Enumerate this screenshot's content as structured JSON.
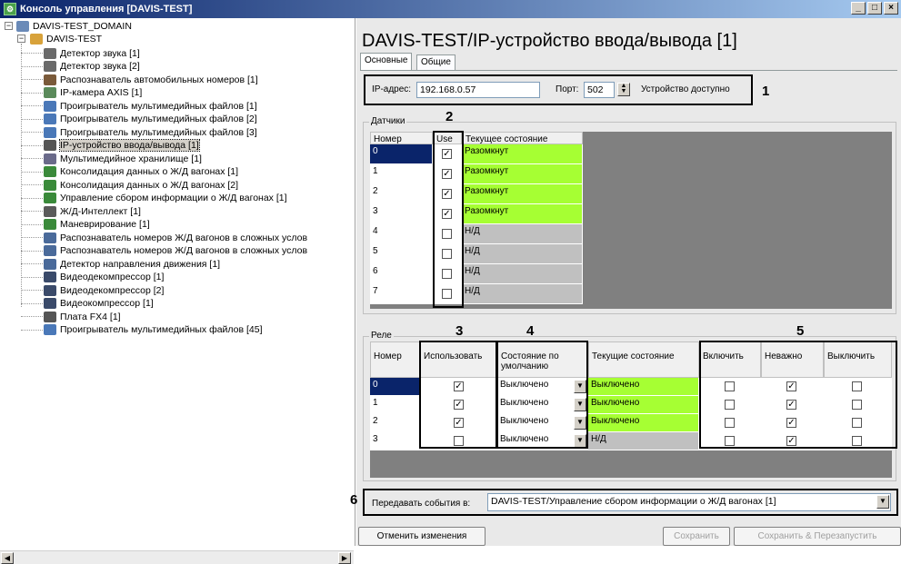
{
  "window": {
    "title": "Консоль управления [DAVIS-TEST]",
    "min": "_",
    "max": "□",
    "close": "×"
  },
  "tree": {
    "root": "DAVIS-TEST_DOMAIN",
    "computer": "DAVIS-TEST",
    "items": [
      {
        "label": "Детектор звука [1]",
        "icon": "sound-detector-icon",
        "color": "#6a6a6a"
      },
      {
        "label": "Детектор звука [2]",
        "icon": "sound-detector-icon",
        "color": "#6a6a6a"
      },
      {
        "label": "Распознаватель автомобильных номеров [1]",
        "icon": "car-plate-icon",
        "color": "#7a5a3a"
      },
      {
        "label": "IP-камера AXIS [1]",
        "icon": "camera-icon",
        "color": "#5a8a5a"
      },
      {
        "label": "Проигрыватель мультимедийных файлов [1]",
        "icon": "player-icon",
        "color": "#4a78b8"
      },
      {
        "label": "Проигрыватель мультимедийных файлов [2]",
        "icon": "player-icon",
        "color": "#4a78b8"
      },
      {
        "label": "Проигрыватель мультимедийных файлов [3]",
        "icon": "player-icon",
        "color": "#4a78b8"
      },
      {
        "label": "IP-устройство ввода/вывода [1]",
        "icon": "io-device-icon",
        "color": "#555555",
        "selected": true
      },
      {
        "label": "Мультимедийное хранилище [1]",
        "icon": "storage-icon",
        "color": "#6a6a8a"
      },
      {
        "label": "Консолидация данных о Ж/Д вагонах [1]",
        "icon": "rail-icon",
        "color": "#3a8a3a"
      },
      {
        "label": "Консолидация данных о Ж/Д вагонах [2]",
        "icon": "rail-icon",
        "color": "#3a8a3a"
      },
      {
        "label": "Управление сбором информации о Ж/Д вагонах [1]",
        "icon": "rail-icon",
        "color": "#3a8a3a"
      },
      {
        "label": "Ж/Д-Интеллект [1]",
        "icon": "rail-intellect-icon",
        "color": "#5a5a5a"
      },
      {
        "label": "Маневрирование [1]",
        "icon": "rail-icon",
        "color": "#3a8a3a"
      },
      {
        "label": "Распознаватель номеров Ж/Д вагонов в сложных услов",
        "icon": "magnifier-icon",
        "color": "#4a6a9a"
      },
      {
        "label": "Распознаватель номеров Ж/Д вагонов в сложных услов",
        "icon": "magnifier-icon",
        "color": "#4a6a9a"
      },
      {
        "label": "Детектор направления движения [1]",
        "icon": "magnifier-icon",
        "color": "#4a6a9a"
      },
      {
        "label": "Видеодекомпрессор [1]",
        "icon": "decompressor-icon",
        "color": "#3a4a6a"
      },
      {
        "label": "Видеодекомпрессор [2]",
        "icon": "decompressor-icon",
        "color": "#3a4a6a"
      },
      {
        "label": "Видеокомпрессор [1]",
        "icon": "compressor-icon",
        "color": "#3a4a6a"
      },
      {
        "label": "Плата FX4 [1]",
        "icon": "board-icon",
        "color": "#555555"
      },
      {
        "label": "Проигрыватель мультимедийных файлов [45]",
        "icon": "player-icon",
        "color": "#4a78b8"
      }
    ]
  },
  "panel": {
    "title": "DAVIS-TEST/IP-устройство ввода/вывода [1]",
    "tabs": [
      "Основные",
      "Общие"
    ],
    "ip_label": "IP-адрес:",
    "ip_value": "192.168.0.57",
    "port_label": "Порт:",
    "port_value": "502",
    "device_status": "Устройство доступно",
    "sensors": {
      "title": "Датчики",
      "headers": [
        "Номер",
        "Use",
        "Текущее состояние"
      ],
      "rows": [
        {
          "num": "0",
          "use": true,
          "state": "Разомкнут"
        },
        {
          "num": "1",
          "use": true,
          "state": "Разомкнут"
        },
        {
          "num": "2",
          "use": true,
          "state": "Разомкнут"
        },
        {
          "num": "3",
          "use": true,
          "state": "Разомкнут"
        },
        {
          "num": "4",
          "use": false,
          "state": "Н/Д"
        },
        {
          "num": "5",
          "use": false,
          "state": "Н/Д"
        },
        {
          "num": "6",
          "use": false,
          "state": "Н/Д"
        },
        {
          "num": "7",
          "use": false,
          "state": "Н/Д"
        }
      ]
    },
    "relays": {
      "title": "Реле",
      "headers": [
        "Номер",
        "Использовать",
        "Состояние по умолчанию",
        "Текущие состояние",
        "Включить",
        "Неважно",
        "Выключить"
      ],
      "rows": [
        {
          "num": "0",
          "use": true,
          "default": "Выключено",
          "current": "Выключено",
          "on": false,
          "any": true,
          "off": false
        },
        {
          "num": "1",
          "use": true,
          "default": "Выключено",
          "current": "Выключено",
          "on": false,
          "any": true,
          "off": false
        },
        {
          "num": "2",
          "use": true,
          "default": "Выключено",
          "current": "Выключено",
          "on": false,
          "any": true,
          "off": false
        },
        {
          "num": "3",
          "use": false,
          "default": "Выключено",
          "current": "Н/Д",
          "on": false,
          "any": true,
          "off": false
        }
      ]
    },
    "events_label": "Передавать события в:",
    "events_target": "DAVIS-TEST/Управление сбором информации о Ж/Д вагонах [1]",
    "callouts": [
      "1",
      "2",
      "3",
      "4",
      "5",
      "6"
    ],
    "buttons": {
      "cancel": "Отменить изменения",
      "save": "Сохранить",
      "save_restart": "Сохранить & Перезапустить"
    },
    "colors": {
      "ok_state": "#a6ff33",
      "na_state": "#c0c0c0",
      "selected_row": "#0a246a"
    }
  }
}
